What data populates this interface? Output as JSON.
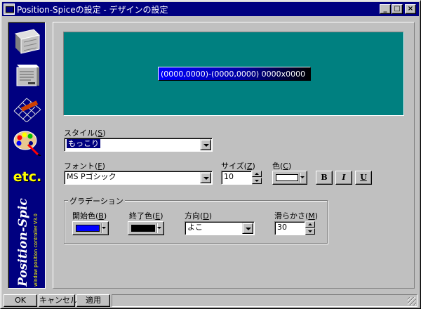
{
  "window": {
    "title": "Position-Spiceの設定 - デザインの設定",
    "minimize_glyph": "_",
    "maximize_glyph": "□",
    "close_glyph": "×"
  },
  "sidebar": {
    "items": [
      {
        "name": "position-settings",
        "icon": "window-position-icon"
      },
      {
        "name": "window-settings",
        "icon": "window-list-icon"
      },
      {
        "name": "grid-settings",
        "icon": "grid-icon"
      },
      {
        "name": "design-settings",
        "icon": "palette-icon"
      },
      {
        "name": "etc-settings",
        "icon": "etc-icon",
        "label": "etc."
      }
    ],
    "brand_title": "Position-Spice",
    "brand_subtitle": "window position controller V3.0"
  },
  "preview": {
    "sample_text": "(0000,0000)-(0000,0000) 0000x0000",
    "background_color": "#008080"
  },
  "style": {
    "label": "スタイル",
    "mnemonic": "S",
    "value": "もっこり"
  },
  "font": {
    "label": "フォント",
    "mnemonic": "F",
    "value": "MS Pゴシック"
  },
  "size": {
    "label": "サイズ",
    "mnemonic": "Z",
    "value": "10"
  },
  "color": {
    "label": "色",
    "mnemonic": "C",
    "value": "#ffffff"
  },
  "font_style_buttons": {
    "bold": "B",
    "italic": "I",
    "underline": "U"
  },
  "gradation": {
    "title": "グラデーション",
    "start_color": {
      "label": "開始色",
      "mnemonic": "B",
      "value": "#0000ff"
    },
    "end_color": {
      "label": "終了色",
      "mnemonic": "E",
      "value": "#000000"
    },
    "direction": {
      "label": "方向",
      "mnemonic": "D",
      "value": "よこ"
    },
    "smoothness": {
      "label": "滑らかさ",
      "mnemonic": "M",
      "value": "30"
    }
  },
  "statusbar": {
    "ok": "OK",
    "cancel": "キャンセル",
    "apply": "適用"
  }
}
